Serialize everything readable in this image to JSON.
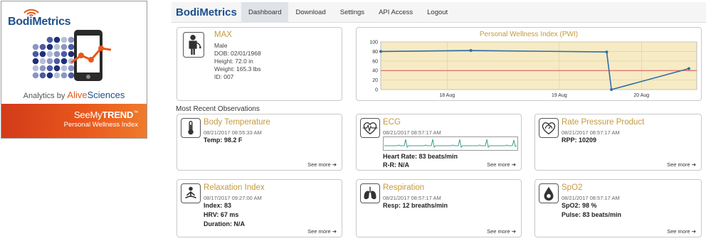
{
  "promo": {
    "logo": "BodiMetrics",
    "analytics_prefix": "Analytics by ",
    "analytics_brand_a": "Alive",
    "analytics_brand_b": "Sciences",
    "product_a": "SeeMy",
    "product_b": "TREND",
    "product_tm": "™",
    "subtitle": "Personal Wellness Index",
    "colors": {
      "brand_blue": "#1e4f8c",
      "orange": "#e8571c"
    }
  },
  "nav": {
    "brand": "BodiMetrics",
    "items": [
      {
        "label": "Dashboard",
        "active": true
      },
      {
        "label": "Download",
        "active": false
      },
      {
        "label": "Settings",
        "active": false
      },
      {
        "label": "API Access",
        "active": false
      },
      {
        "label": "Logout",
        "active": false
      }
    ]
  },
  "profile": {
    "name": "MAX",
    "gender": "Male",
    "dob": "DOB: 02/01/1968",
    "height": "Height: 72.0 in",
    "weight": "Weight: 165.3 lbs",
    "id": "ID: 007",
    "icon": "person-icon"
  },
  "chart_data": {
    "type": "line",
    "title": "Personal Wellness Index (PWI)",
    "xlabel": "",
    "ylabel": "",
    "ylim": [
      0,
      100
    ],
    "yticks": [
      0,
      20,
      40,
      60,
      80,
      100
    ],
    "xtick_labels": [
      "18 Aug",
      "19 Aug",
      "20 Aug"
    ],
    "xtick_positions": [
      0.21,
      0.565,
      0.825
    ],
    "reference_line": 40,
    "reference_color": "#d9534f",
    "series": [
      {
        "color": "#2f6fa5",
        "points": [
          {
            "x": 0.0,
            "y": 80
          },
          {
            "x": 0.285,
            "y": 82
          },
          {
            "x": 0.715,
            "y": 79
          },
          {
            "x": 0.73,
            "y": 0
          },
          {
            "x": 0.975,
            "y": 44
          }
        ]
      }
    ],
    "background": "#f6ebc4"
  },
  "recent_label": "Most Recent Observations",
  "see_more": "See more ➔",
  "observations": {
    "body_temp": {
      "title": "Body Temperature",
      "date": "08/21/2017 08:55:33 AM",
      "line1": "Temp: 98.2 F",
      "icon": "thermometer-icon"
    },
    "ecg": {
      "title": "ECG",
      "date": "08/21/2017 08:57:17 AM",
      "line1": "Heart Rate: 83 beats/min",
      "line2": "R-R: N/A",
      "icon": "heart-pulse-icon"
    },
    "rpp": {
      "title": "Rate Pressure Product",
      "date": "08/21/2017 08:57:17 AM",
      "line1": "RPP: 10209",
      "icon": "heart-gauge-icon"
    },
    "relax": {
      "title": "Relaxation Index",
      "date": "08/17/2017 09:27:00 AM",
      "line1": "Index: 83",
      "line2": "HRV: 67 ms",
      "line3": "Duration: N/A",
      "icon": "meditation-icon"
    },
    "resp": {
      "title": "Respiration",
      "date": "08/21/2017 08:57:17 AM",
      "line1": "Resp: 12 breaths/min",
      "icon": "lungs-icon"
    },
    "spo2": {
      "title": "SpO2",
      "date": "08/21/2017 08:57:17 AM",
      "line1": "SpO2: 98 %",
      "line2": "Pulse: 83 beats/min",
      "icon": "drop-icon"
    }
  }
}
